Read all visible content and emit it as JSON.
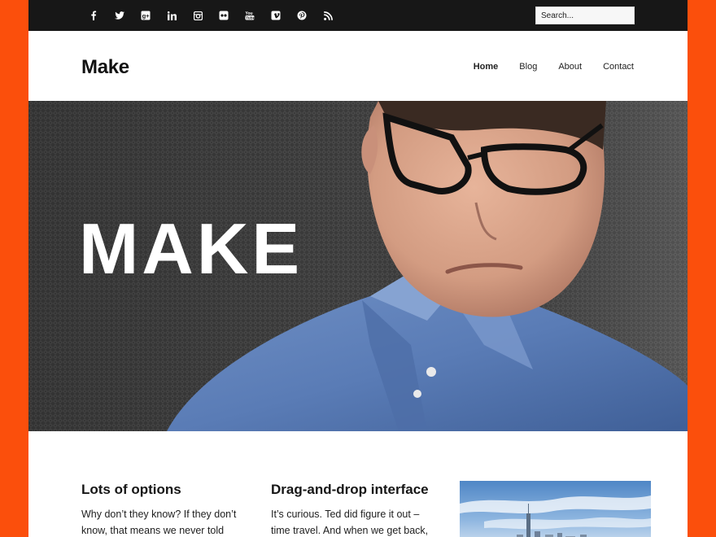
{
  "social": {
    "icons": [
      "facebook-icon",
      "twitter-icon",
      "google-plus-icon",
      "linkedin-icon",
      "instagram-icon",
      "flickr-icon",
      "youtube-icon",
      "vimeo-icon",
      "pinterest-icon",
      "rss-icon"
    ]
  },
  "search": {
    "placeholder": "Search..."
  },
  "header": {
    "logo": "Make",
    "nav": [
      "Home",
      "Blog",
      "About",
      "Contact"
    ]
  },
  "hero": {
    "title": "MAKE"
  },
  "features": [
    {
      "title": "Lots of options",
      "text": "Why don’t they know? If they don’t know, that means we never told"
    },
    {
      "title": "Drag-and-drop interface",
      "text": "It’s curious. Ted did figure it out – time travel. And when we get back,"
    }
  ],
  "colors": {
    "frame": "#fb4f0c",
    "topbar": "#171717",
    "text": "#161616"
  }
}
